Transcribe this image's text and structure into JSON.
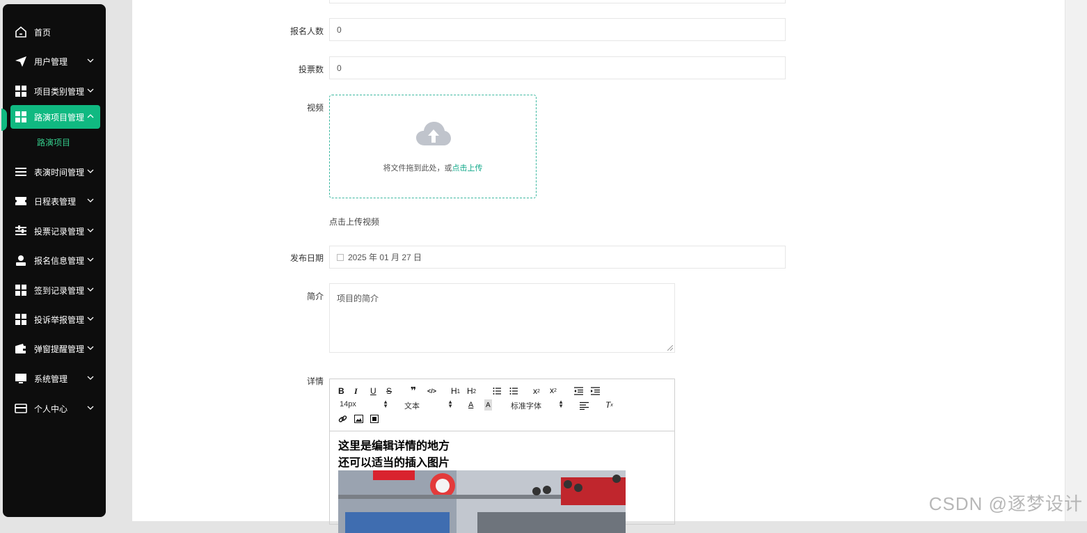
{
  "sidebar": {
    "items": [
      {
        "label": "首页",
        "icon": "home-icon",
        "has_chevron": false
      },
      {
        "label": "用户管理",
        "icon": "paper-plane-icon",
        "has_chevron": true
      },
      {
        "label": "项目类别管理",
        "icon": "grid-icon",
        "has_chevron": true
      },
      {
        "label": "路演项目管理",
        "icon": "grid-icon",
        "has_chevron": true,
        "active": true,
        "expanded": true
      },
      {
        "label": "表演时间管理",
        "icon": "list-icon",
        "has_chevron": true
      },
      {
        "label": "日程表管理",
        "icon": "ticket-icon",
        "has_chevron": true
      },
      {
        "label": "投票记录管理",
        "icon": "sliders-icon",
        "has_chevron": true
      },
      {
        "label": "报名信息管理",
        "icon": "user-icon",
        "has_chevron": true
      },
      {
        "label": "签到记录管理",
        "icon": "grid-icon",
        "has_chevron": true
      },
      {
        "label": "投诉举报管理",
        "icon": "grid-icon",
        "has_chevron": true
      },
      {
        "label": "弹窗提醒管理",
        "icon": "wallet-icon",
        "has_chevron": true
      },
      {
        "label": "系统管理",
        "icon": "monitor-icon",
        "has_chevron": true
      },
      {
        "label": "个人中心",
        "icon": "card-icon",
        "has_chevron": true
      }
    ],
    "sub_item": "路演项目",
    "active_color": "#10b981"
  },
  "form": {
    "signup_count": {
      "label": "报名人数",
      "value": "0"
    },
    "vote_count": {
      "label": "投票数",
      "value": "0"
    },
    "video": {
      "label": "视频",
      "upload_text": "将文件拖到此处，或",
      "upload_link": "点击上传",
      "hint": "点击上传视频"
    },
    "publish_date": {
      "label": "发布日期",
      "value": "2025 年 01 月 27 日"
    },
    "intro": {
      "label": "简介",
      "placeholder": "项目的简介"
    },
    "details": {
      "label": "详情",
      "font_size": "14px",
      "block_type": "文本",
      "font_family": "标准字体",
      "line1": "这里是编辑详情的地方",
      "line2": "还可以适当的插入图片"
    }
  },
  "watermark": "CSDN @逐梦设计"
}
